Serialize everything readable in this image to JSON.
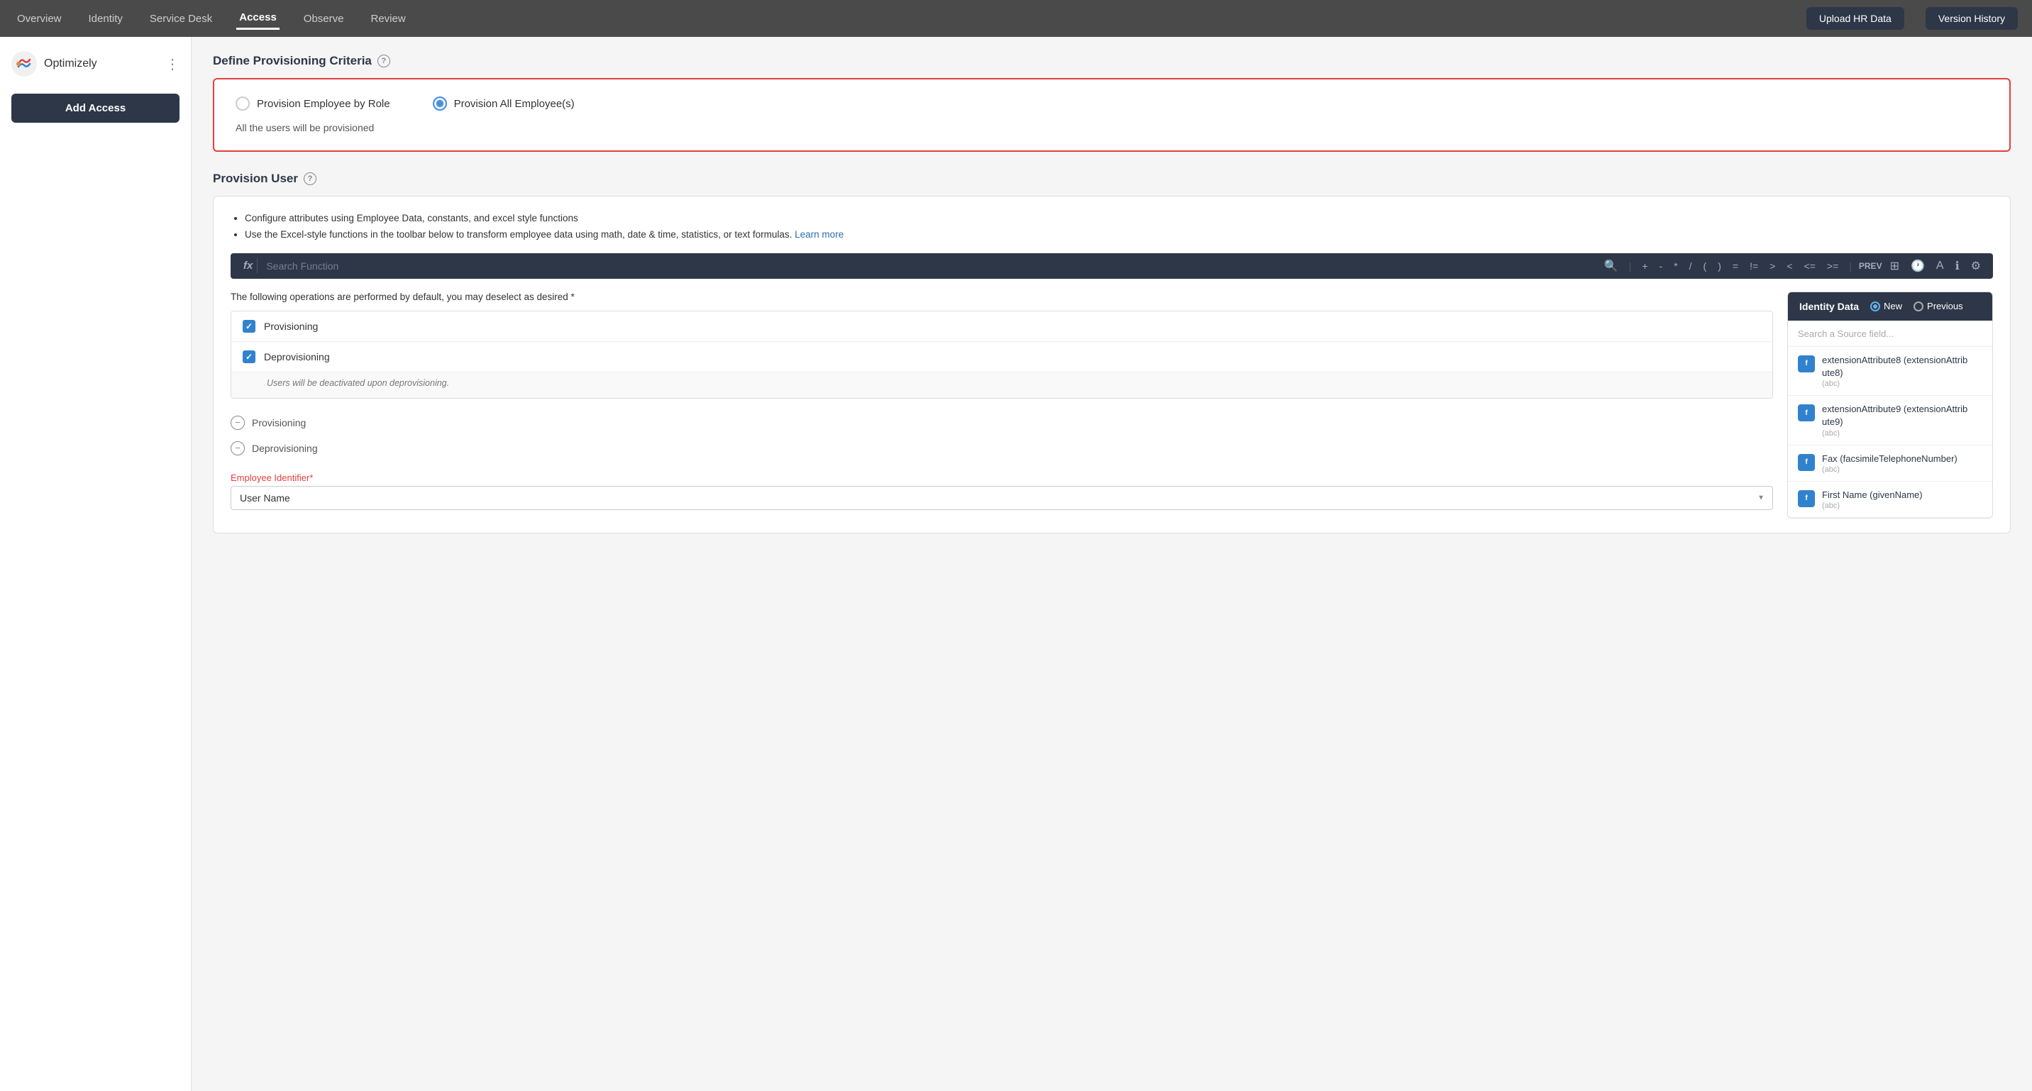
{
  "nav": {
    "items": [
      {
        "label": "Overview",
        "active": false
      },
      {
        "label": "Identity",
        "active": false
      },
      {
        "label": "Service Desk",
        "active": false
      },
      {
        "label": "Access",
        "active": true
      },
      {
        "label": "Observe",
        "active": false
      },
      {
        "label": "Review",
        "active": false
      }
    ],
    "upload_btn": "Upload HR Data",
    "version_btn": "Version History"
  },
  "sidebar": {
    "logo_name": "Optimizely",
    "add_access_label": "Add Access"
  },
  "criteria": {
    "section_title": "Define Provisioning Criteria",
    "option1_label": "Provision Employee by Role",
    "option2_label": "Provision All Employee(s)",
    "note": "All the users will be provisioned"
  },
  "provision": {
    "section_title": "Provision User",
    "desc_line1": "Configure attributes using Employee Data, constants, and excel style functions",
    "desc_line2": "Use the Excel-style functions in the toolbar below to transform employee data using math, date & time, statistics, or text formulas.",
    "learn_more": "Learn more",
    "fx_label": "fx",
    "search_placeholder": "Search Function",
    "toolbar_ops": [
      "+",
      "-",
      "*",
      "/",
      "(",
      ")",
      "=",
      "!=",
      ">",
      "<",
      "<=",
      ">="
    ],
    "prev_label": "PREV",
    "operations_note": "The following operations are performed by default, you may deselect as desired *",
    "op1_label": "Provisioning",
    "op2_label": "Deprovisioning",
    "op2_note": "Users will be deactivated upon deprovisioning.",
    "circle1_label": "Provisioning",
    "circle2_label": "Deprovisioning",
    "emp_id_label": "Employee Identifier*",
    "emp_id_value": "User Name"
  },
  "identity_panel": {
    "title": "Identity Data",
    "radio_new": "New",
    "radio_prev": "Previous",
    "search_placeholder": "Search a Source field...",
    "fields": [
      {
        "name": "extensionAttribute8 (extensionAttribute8)",
        "type": "(abc)"
      },
      {
        "name": "extensionAttribute9 (extensionAttribute9)",
        "type": "(abc)"
      },
      {
        "name": "Fax (facsimileTelephoneNumber)",
        "type": "(abc)"
      },
      {
        "name": "First Name (givenName)",
        "type": "(abc)"
      }
    ]
  }
}
